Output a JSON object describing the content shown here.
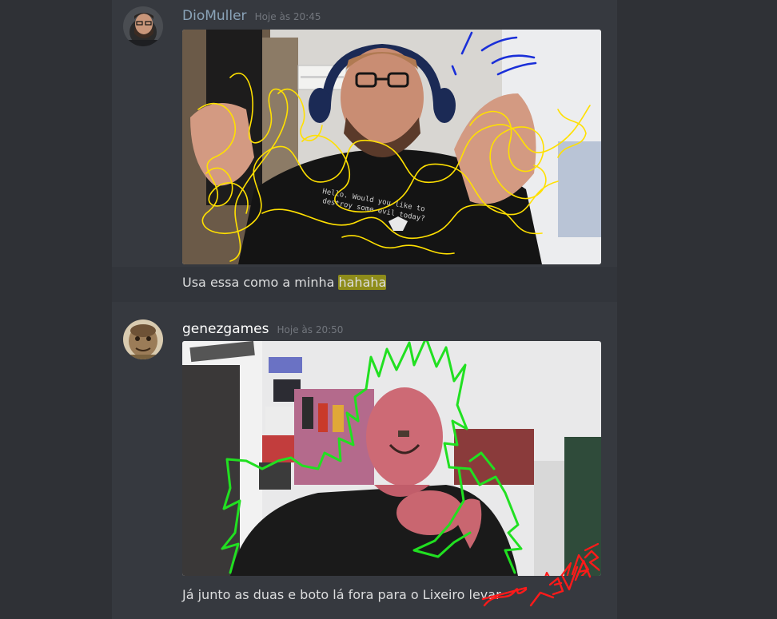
{
  "messages": [
    {
      "username": "DioMuller",
      "username_color": "#8aa3b8",
      "timestamp": "Hoje às 20:45",
      "text_before": "Usa essa como a minha ",
      "text_highlight": "hahaha",
      "attachment": "webcam photo of bearded man with headset making a face, scribbled over in yellow and blue"
    },
    {
      "username": "genezgames",
      "username_color": "#ffffff",
      "timestamp": "Hoje às 20:50",
      "text_before": "Já junto as duas e boto lá fora para o Lixeiro ",
      "text_struck": "levar",
      "handwritten": "LEVAR",
      "attachment": "webcam photo of bald man with goatee in a collectibles room, green spiky hair drawn over"
    }
  ],
  "colors": {
    "background": "#36393f",
    "sidebar_bg": "#2f3136",
    "highlight": "#dbd300",
    "scribble_yellow": "#ffe000",
    "scribble_blue": "#1a2fd8",
    "scribble_green": "#21e021",
    "scribble_red": "#ff1a1a"
  }
}
